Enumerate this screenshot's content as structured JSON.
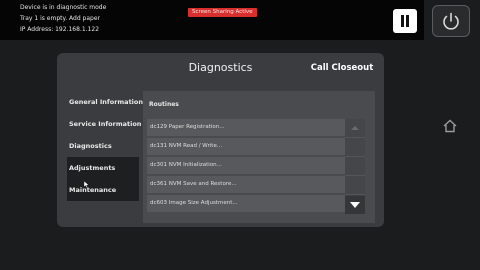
{
  "status": {
    "line1": "Device is in diagnostic mode",
    "line2": "Tray 1 is empty.  Add paper",
    "line3": "IP Address: 192.168.1.122",
    "badge": "Screen Sharing Active"
  },
  "panel": {
    "title": "Diagnostics",
    "call_closeout": "Call Closeout"
  },
  "nav": {
    "items": [
      {
        "label": "General Information"
      },
      {
        "label": "Service Information"
      },
      {
        "label": "Diagnostics"
      },
      {
        "label": "Adjustments"
      },
      {
        "label": "Maintenance"
      }
    ]
  },
  "list": {
    "header": "Routines",
    "rows": [
      {
        "label": "dc129 Paper Registration..."
      },
      {
        "label": "dc131 NVM Read / Write..."
      },
      {
        "label": "dc301 NVM Initialization..."
      },
      {
        "label": "dc361 NVM Save and Restore..."
      },
      {
        "label": "dc603 Image Size Adjustment..."
      }
    ]
  },
  "icons": {
    "pause": "pause-icon",
    "power": "power-icon",
    "home": "home-icon",
    "scroll_down": "arrow-down-icon"
  },
  "colors": {
    "badge": "#d9302f",
    "panel": "#3b3c3f",
    "background": "#1b1c1e"
  }
}
